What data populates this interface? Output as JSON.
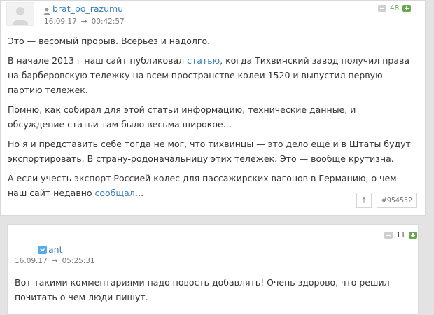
{
  "comments": [
    {
      "username": "brat_po_razumu",
      "date": "16.09.17",
      "arrow": "→",
      "time": "00:42:57",
      "score": "48",
      "paragraphs": [
        {
          "parts": [
            "Это — весомый прорыв. Всерьез и надолго."
          ]
        },
        {
          "parts": [
            "В начале 2013 г наш сайт публиковал ",
            "статью",
            ", когда Тихвинский завод получил права на барберовскую тележку на всем пространстве колеи 1520 и выпустил первую партию тележек."
          ]
        },
        {
          "parts": [
            "Помню, как собирал для этой статьи информацию, технические данные, и обсуждение статьи там было весьма широкое…"
          ]
        },
        {
          "parts": [
            "Но я и представить себе тогда не мог, что тихвинцы — это дело еще и в Штаты будут экспортировать. В страну-родоначальницу этих тележек. Это — вообще крутизна."
          ]
        },
        {
          "parts": [
            "А если учесть экспорт Россией колес для пассажирских вагонов в Германию, о чем наш сайт недавно ",
            "сообщал",
            "…"
          ]
        }
      ],
      "up_label": "↑",
      "comment_id": "#954552"
    },
    {
      "username": "ant",
      "date": "16.09.17",
      "arrow": "→",
      "time": "05:25:31",
      "score": "11",
      "text": "Вот такими комментариями надо новость добавлять! Очень здорово, что решил почитать о чем люди пишут."
    }
  ],
  "colors": {
    "link": "#3b7fb3",
    "positive": "#6aa84f",
    "background": "#e3e3e3"
  },
  "icons": {
    "avatar_placeholder": "user-silhouette-icon",
    "user_marker": "user-icon",
    "twitter": "twitter-icon"
  }
}
